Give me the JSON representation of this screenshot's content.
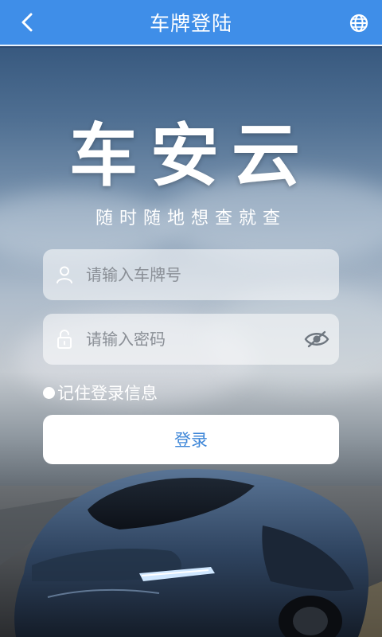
{
  "header": {
    "title": "车牌登陆",
    "back_icon": "chevron-left-icon",
    "globe_icon": "globe-icon"
  },
  "brand": {
    "logo": "车安云",
    "slogan": "随时随地想查就查"
  },
  "form": {
    "plate": {
      "placeholder": "请输入车牌号",
      "value": "",
      "icon": "user-icon"
    },
    "password": {
      "placeholder": "请输入密码",
      "value": "",
      "icon": "lock-icon",
      "toggle_icon": "eye-hidden-icon"
    },
    "remember_label": "记住登录信息",
    "login_label": "登录"
  },
  "colors": {
    "header_bg": "#3f8ee8",
    "button_text": "#3f87d8"
  }
}
